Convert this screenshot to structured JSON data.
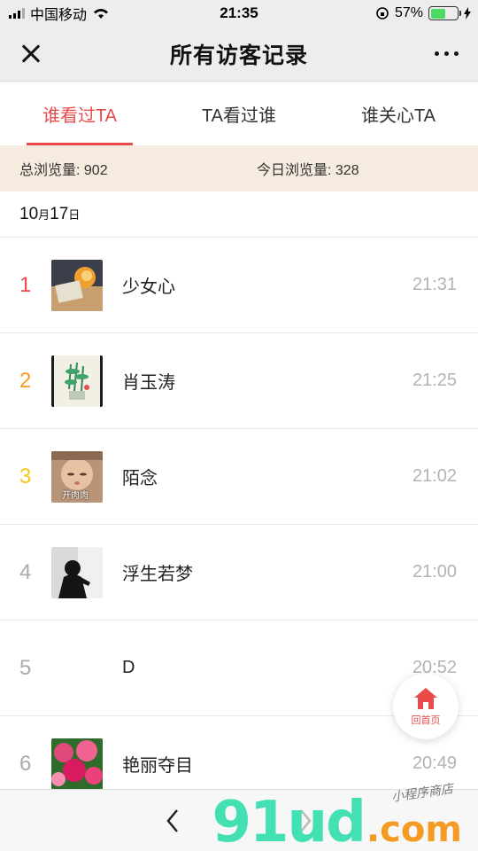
{
  "status": {
    "carrier": "中国移动",
    "time": "21:35",
    "battery": "57%",
    "battery_level": 0.57
  },
  "header": {
    "title": "所有访客记录"
  },
  "tabs": [
    {
      "label": "谁看过TA"
    },
    {
      "label": "TA看过谁"
    },
    {
      "label": "谁关心TA"
    }
  ],
  "stats": {
    "total": "总浏览量: 902",
    "today": "今日浏览量: 328"
  },
  "date": {
    "num1": "10",
    "unit1": "月",
    "num2": "17",
    "unit2": "日"
  },
  "visitors": [
    {
      "rank": "1",
      "name": "少女心",
      "time": "21:31",
      "rank_color": "#e94b4b"
    },
    {
      "rank": "2",
      "name": "肖玉涛",
      "time": "21:25",
      "rank_color": "#f59a23"
    },
    {
      "rank": "3",
      "name": "陌念",
      "time": "21:02",
      "rank_color": "#f5c518",
      "avatar_caption": "开肉肉"
    },
    {
      "rank": "4",
      "name": "浮生若梦",
      "time": "21:00",
      "rank_color": "#aaaaaa"
    },
    {
      "rank": "5",
      "name": "D",
      "time": "20:52",
      "rank_color": "#aaaaaa"
    },
    {
      "rank": "6",
      "name": "艳丽夺目",
      "time": "20:49",
      "rank_color": "#aaaaaa"
    }
  ],
  "home_button": {
    "label": "回首页"
  },
  "watermark": {
    "brand": "91ud",
    "suffix": ".com",
    "tagline": "小程序商店"
  },
  "colors": {
    "accent": "#e94b4b",
    "stats_bg": "#f5ebdf"
  }
}
